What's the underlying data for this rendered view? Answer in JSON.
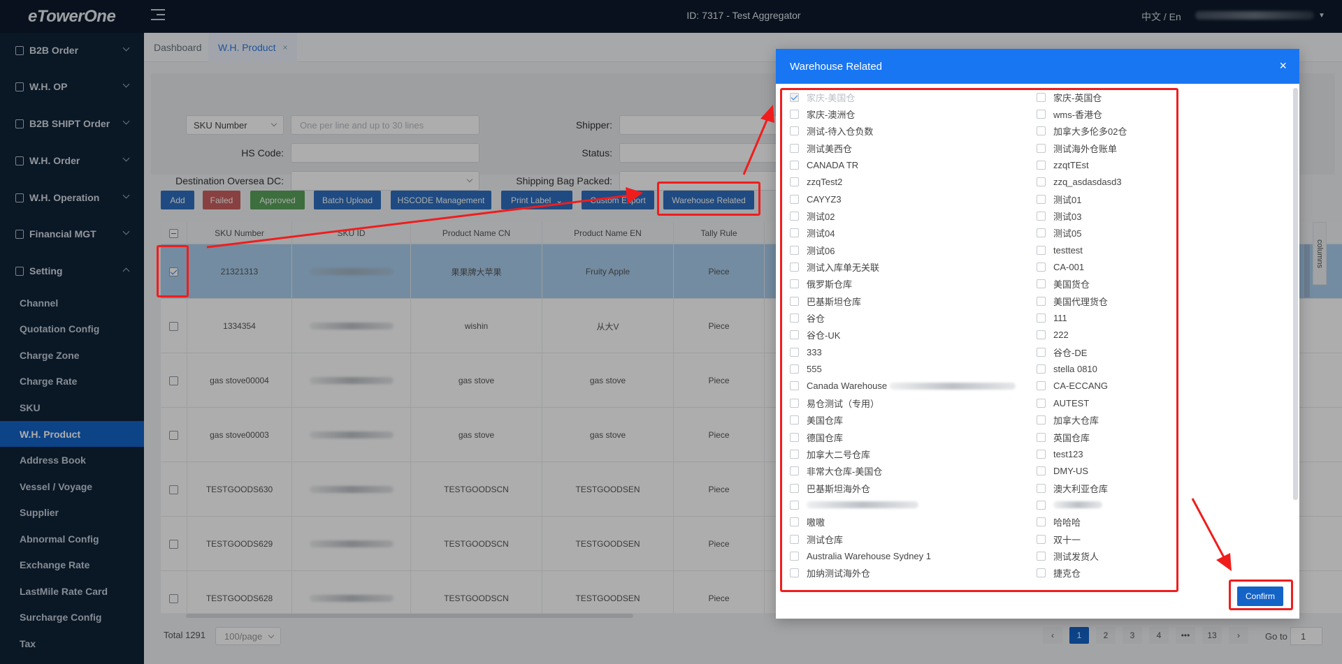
{
  "topbar": {
    "logo": "eTowerOne",
    "center_title": "ID: 7317 - Test Aggregator",
    "lang": "中文 / En"
  },
  "sidebar": {
    "groups": [
      {
        "label": "B2B Order",
        "icon": "building-icon"
      },
      {
        "label": "W.H. OP",
        "icon": "list-icon"
      },
      {
        "label": "B2B SHIPT Order",
        "icon": "lock-icon"
      },
      {
        "label": "W.H. Order",
        "icon": "order-icon"
      },
      {
        "label": "W.H. Operation",
        "icon": "house-icon"
      },
      {
        "label": "Financial MGT",
        "icon": "yen-icon"
      },
      {
        "label": "Setting",
        "icon": "grid-icon"
      }
    ],
    "sub_items": [
      "Channel",
      "Quotation Config",
      "Charge Zone",
      "Charge Rate",
      "SKU",
      "W.H. Product",
      "Address Book",
      "Vessel / Voyage",
      "Supplier",
      "Abnormal Config",
      "Exchange Rate",
      "LastMile Rate Card",
      "Surcharge Config",
      "Tax"
    ],
    "active_sub": "W.H. Product"
  },
  "tabs": [
    {
      "label": "Dashboard"
    },
    {
      "label": "W.H. Product",
      "close": "×"
    }
  ],
  "filters": {
    "sku_select": "SKU Number",
    "sku_placeholder": "One per line and up to 30 lines",
    "hs_code_label": "HS Code:",
    "dest_dc_label": "Destination Oversea DC:",
    "shipper_label": "Shipper:",
    "status_label": "Status:",
    "bag_label": "Shipping Bag Packed:"
  },
  "toolbar": {
    "add": "Add",
    "failed": "Failed",
    "approved": "Approved",
    "batch_upload": "Batch Upload",
    "hscode": "HSCODE Management",
    "print_label": "Print Label",
    "custom_export": "Custom Export",
    "warehouse_related": "Warehouse Related"
  },
  "table": {
    "columns": [
      "SKU Number",
      "SKU ID",
      "Product Name CN",
      "Product Name EN",
      "Tally Rule"
    ],
    "rows": [
      {
        "sku": "21321313",
        "name_cn": "果果牌大苹果",
        "name_en": "Fruity Apple",
        "tally": "Piece",
        "selected": true
      },
      {
        "sku": "1334354",
        "name_cn": "wishin",
        "name_en": "从大V",
        "tally": "Piece",
        "selected": false
      },
      {
        "sku": "gas stove00004",
        "name_cn": "gas stove",
        "name_en": "gas stove",
        "tally": "Piece",
        "selected": false
      },
      {
        "sku": "gas stove00003",
        "name_cn": "gas stove",
        "name_en": "gas stove",
        "tally": "Piece",
        "selected": false
      },
      {
        "sku": "TESTGOODS630",
        "name_cn": "TESTGOODSCN",
        "name_en": "TESTGOODSEN",
        "tally": "Piece",
        "selected": false
      },
      {
        "sku": "TESTGOODS629",
        "name_cn": "TESTGOODSCN",
        "name_en": "TESTGOODSEN",
        "tally": "Piece",
        "selected": false
      },
      {
        "sku": "TESTGOODS628",
        "name_cn": "TESTGOODSCN",
        "name_en": "TESTGOODSEN",
        "tally": "Piece",
        "selected": false
      }
    ],
    "columns_tab": "columns"
  },
  "pagination": {
    "total": "Total 1291",
    "page_size": "100/page",
    "pages": [
      "1",
      "2",
      "3",
      "4",
      "•••",
      "13"
    ],
    "prev": "‹",
    "next": "›",
    "goto_label": "Go to",
    "goto_value": "1"
  },
  "modal": {
    "title": "Warehouse Related",
    "close": "×",
    "left_options": [
      "家庆-美国仓",
      "家庆-澳洲仓",
      "测试-待入仓负数",
      "测试美西仓",
      "CANADA TR",
      "zzqTest2",
      "CAYYZ3",
      "测试02",
      "测试04",
      "测试06",
      "测试入库单无关联",
      "俄罗斯仓库",
      "巴基斯坦仓库",
      "谷仓",
      "谷仓-UK",
      "333",
      "555",
      "Canada Warehouse",
      "易仓测试（专用）",
      "美国仓库",
      "德国仓库",
      "加拿大二号仓库",
      "非常大仓库-美国仓",
      "巴基斯坦海外仓",
      "",
      "嗷嗷",
      "测试仓库",
      "Australia Warehouse Sydney 1",
      "加纳测试海外仓"
    ],
    "right_options": [
      "家庆-英国仓",
      "wms-香港仓",
      "加拿大多伦多02仓",
      "测试海外仓账单",
      "zzqtTEst",
      "zzq_asdasdasd3",
      "测试01",
      "测试03",
      "测试05",
      "testtest",
      "CA-001",
      "美国货仓",
      "美国代理货仓",
      "111",
      "222",
      "谷仓-DE",
      "stella 0810",
      "CA-ECCANG",
      "AUTEST",
      "加拿大仓库",
      "英国仓库",
      "test123",
      "DMY-US",
      "澳大利亚仓库",
      "",
      "哈哈哈",
      "双十一",
      "测试发货人",
      "捷克仓"
    ],
    "confirm": "Confirm"
  },
  "colors": {
    "topbar": "#0c1a2b",
    "sidebar": "#0f2237",
    "accent": "#1463c7",
    "modal_header": "#1876f2",
    "annotation": "#f01d1d"
  }
}
